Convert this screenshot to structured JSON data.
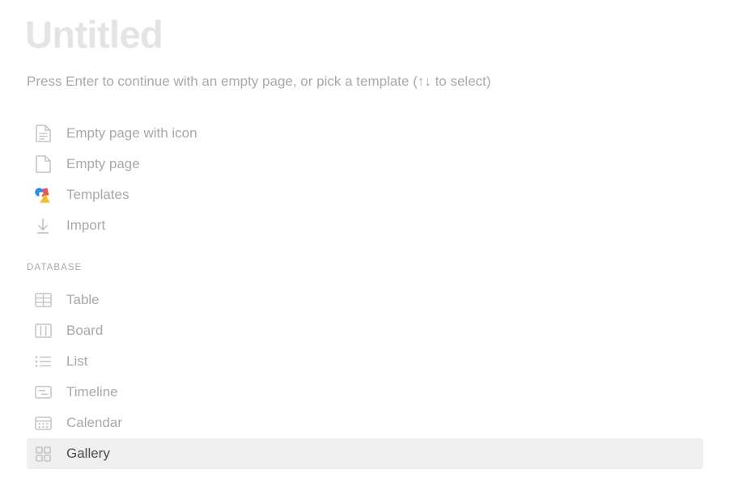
{
  "page": {
    "title_placeholder": "Untitled",
    "hint": "Press Enter to continue with an empty page, or pick a template (↑↓ to select)"
  },
  "colors": {
    "title_placeholder": "#e4e4e4",
    "muted_text": "#a8a8a8",
    "selected_text": "#4d4d4d",
    "selected_background": "#efefef",
    "icon_stroke": "#c4c4c4",
    "templates_blue": "#2e8ae6",
    "templates_red": "#e8564f",
    "templates_yellow": "#f5bb2b"
  },
  "basic_options": [
    {
      "label": "Empty page with icon",
      "icon": "document-lines-icon",
      "selected": false
    },
    {
      "label": "Empty page",
      "icon": "document-blank-icon",
      "selected": false
    },
    {
      "label": "Templates",
      "icon": "templates-shapes-icon",
      "selected": false
    },
    {
      "label": "Import",
      "icon": "download-arrow-icon",
      "selected": false
    }
  ],
  "database_section": {
    "header": "DATABASE",
    "options": [
      {
        "label": "Table",
        "icon": "table-grid-icon",
        "selected": false
      },
      {
        "label": "Board",
        "icon": "board-columns-icon",
        "selected": false
      },
      {
        "label": "List",
        "icon": "list-bullets-icon",
        "selected": false
      },
      {
        "label": "Timeline",
        "icon": "timeline-bars-icon",
        "selected": false
      },
      {
        "label": "Calendar",
        "icon": "calendar-icon",
        "selected": false
      },
      {
        "label": "Gallery",
        "icon": "gallery-squares-icon",
        "selected": true
      }
    ]
  }
}
